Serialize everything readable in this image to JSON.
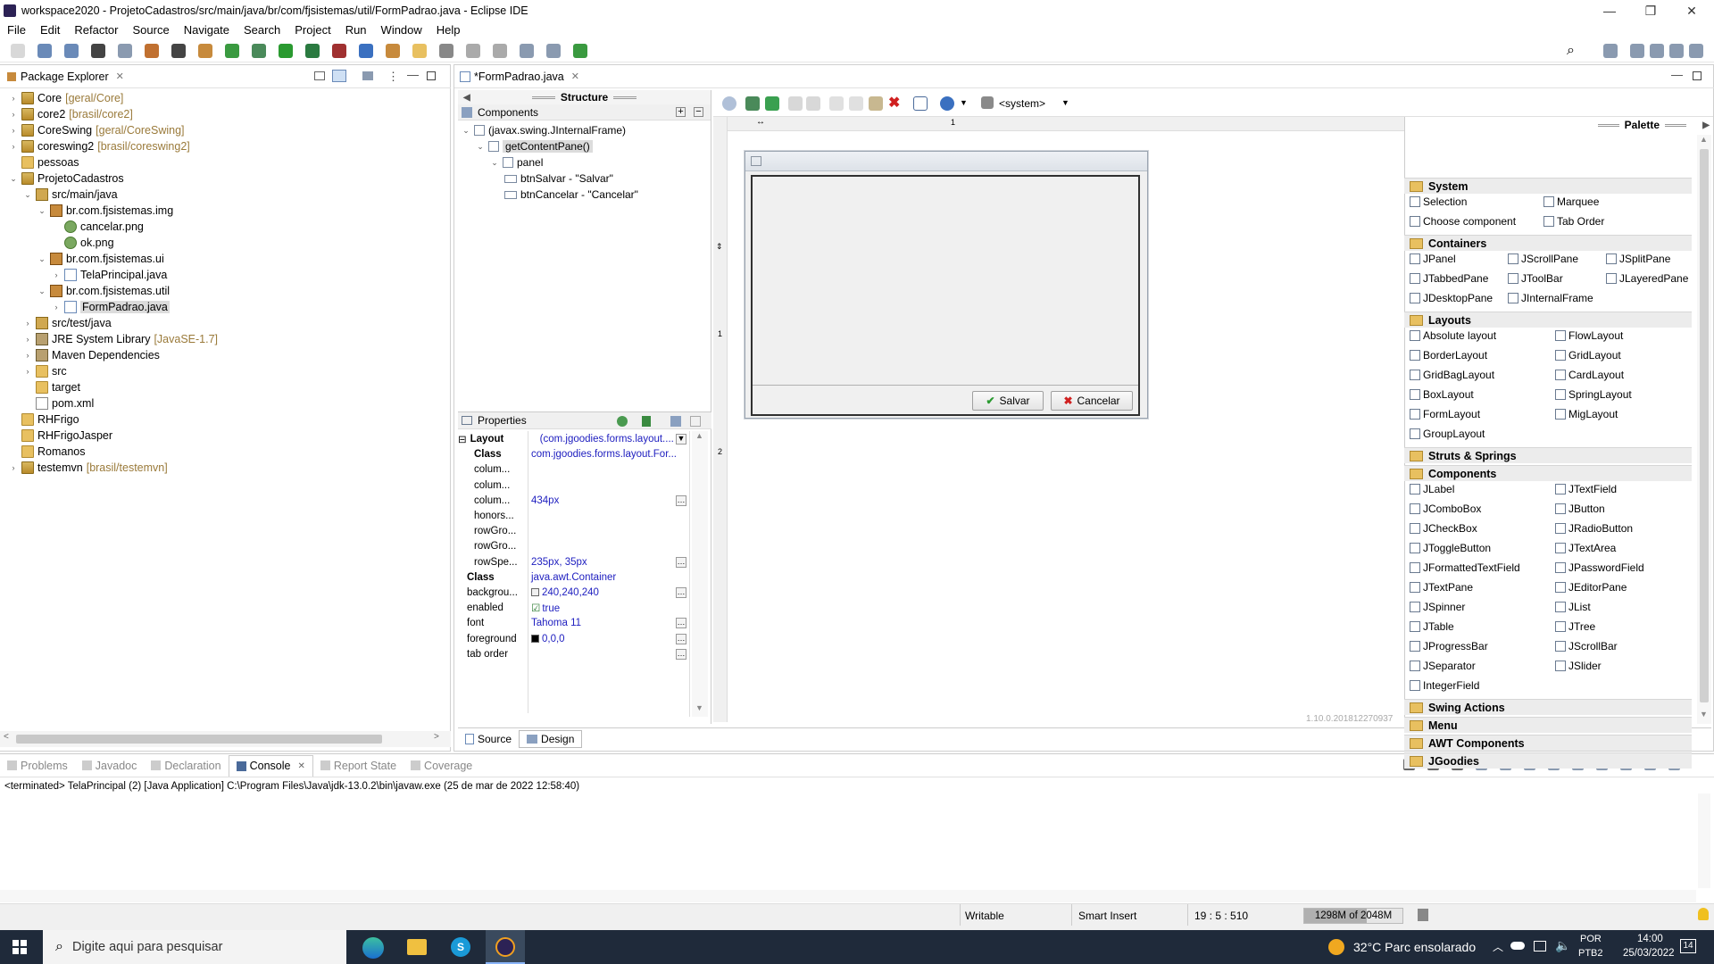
{
  "window": {
    "title": "workspace2020 - ProjetoCadastros/src/main/java/br/com/fjsistemas/util/FormPadrao.java - Eclipse IDE"
  },
  "menu": [
    "File",
    "Edit",
    "Refactor",
    "Source",
    "Navigate",
    "Search",
    "Project",
    "Run",
    "Window",
    "Help"
  ],
  "package_explorer": {
    "tab": "Package Explorer",
    "items": [
      {
        "label": "Core",
        "dec": "[geral/Core]",
        "icon": "project",
        "indent": 0,
        "twisty": ">"
      },
      {
        "label": "core2",
        "dec": "[brasil/core2]",
        "icon": "project",
        "indent": 0,
        "twisty": ">"
      },
      {
        "label": "CoreSwing",
        "dec": "[geral/CoreSwing]",
        "icon": "project",
        "indent": 0,
        "twisty": ">"
      },
      {
        "label": "coreswing2",
        "dec": "[brasil/coreswing2]",
        "icon": "project",
        "indent": 0,
        "twisty": ">"
      },
      {
        "label": "pessoas",
        "dec": "",
        "icon": "project-closed",
        "indent": 0,
        "twisty": ""
      },
      {
        "label": "ProjetoCadastros",
        "dec": "",
        "icon": "project",
        "indent": 0,
        "twisty": "v"
      },
      {
        "label": "src/main/java",
        "dec": "",
        "icon": "source-folder",
        "indent": 1,
        "twisty": "v"
      },
      {
        "label": "br.com.fjsistemas.img",
        "dec": "",
        "icon": "package",
        "indent": 2,
        "twisty": "v"
      },
      {
        "label": "cancelar.png",
        "dec": "",
        "icon": "image",
        "indent": 3,
        "twisty": ""
      },
      {
        "label": "ok.png",
        "dec": "",
        "icon": "image",
        "indent": 3,
        "twisty": ""
      },
      {
        "label": "br.com.fjsistemas.ui",
        "dec": "",
        "icon": "package",
        "indent": 2,
        "twisty": "v"
      },
      {
        "label": "TelaPrincipal.java",
        "dec": "",
        "icon": "java",
        "indent": 3,
        "twisty": ">"
      },
      {
        "label": "br.com.fjsistemas.util",
        "dec": "",
        "icon": "package",
        "indent": 2,
        "twisty": "v"
      },
      {
        "label": "FormPadrao.java",
        "dec": "",
        "icon": "java",
        "indent": 3,
        "twisty": ">",
        "selected": true
      },
      {
        "label": "src/test/java",
        "dec": "",
        "icon": "source-folder",
        "indent": 1,
        "twisty": ">"
      },
      {
        "label": "JRE System Library",
        "dec": "[JavaSE-1.7]",
        "icon": "library",
        "indent": 1,
        "twisty": ">"
      },
      {
        "label": "Maven Dependencies",
        "dec": "",
        "icon": "library",
        "indent": 1,
        "twisty": ">"
      },
      {
        "label": "src",
        "dec": "",
        "icon": "folder",
        "indent": 1,
        "twisty": ">"
      },
      {
        "label": "target",
        "dec": "",
        "icon": "folder",
        "indent": 1,
        "twisty": ""
      },
      {
        "label": "pom.xml",
        "dec": "",
        "icon": "xml",
        "indent": 1,
        "twisty": ""
      },
      {
        "label": "RHFrigo",
        "dec": "",
        "icon": "project-closed",
        "indent": 0,
        "twisty": ""
      },
      {
        "label": "RHFrigoJasper",
        "dec": "",
        "icon": "project-closed",
        "indent": 0,
        "twisty": ""
      },
      {
        "label": "Romanos",
        "dec": "",
        "icon": "project-closed",
        "indent": 0,
        "twisty": ""
      },
      {
        "label": "testemvn",
        "dec": "[brasil/testemvn]",
        "icon": "project",
        "indent": 0,
        "twisty": ">"
      }
    ]
  },
  "editor": {
    "tab": "*FormPadrao.java",
    "structure_title": "Structure",
    "components_title": "Components",
    "components": [
      {
        "label": "(javax.swing.JInternalFrame)",
        "indent": 0
      },
      {
        "label": "getContentPane()",
        "indent": 1
      },
      {
        "label": "panel",
        "indent": 2
      },
      {
        "label": "btnSalvar - \"Salvar\"",
        "indent": 3
      },
      {
        "label": "btnCancelar - \"Cancelar\"",
        "indent": 3
      }
    ],
    "properties_title": "Properties",
    "properties": [
      {
        "k": "Layout",
        "v": "(com.jgoodies.forms.layout....",
        "bold": true,
        "group": true
      },
      {
        "k": "Class",
        "v": "com.jgoodies.forms.layout.For...",
        "bold": true
      },
      {
        "k": "colum...",
        "v": ""
      },
      {
        "k": "colum...",
        "v": ""
      },
      {
        "k": "colum...",
        "v": "434px",
        "more": true
      },
      {
        "k": "honors...",
        "v": ""
      },
      {
        "k": "rowGro...",
        "v": ""
      },
      {
        "k": "rowGro...",
        "v": ""
      },
      {
        "k": "rowSpe...",
        "v": "235px, 35px",
        "more": true
      },
      {
        "k": "Class",
        "v": "java.awt.Container",
        "bold": true,
        "top": true
      },
      {
        "k": "backgrou...",
        "v": "240,240,240",
        "more": true,
        "swatch": "#f0f0f0",
        "top": true
      },
      {
        "k": "enabled",
        "v": "true",
        "check": true,
        "top": true
      },
      {
        "k": "font",
        "v": "Tahoma 11",
        "more": true,
        "top": true
      },
      {
        "k": "foreground",
        "v": "0,0,0",
        "more": true,
        "swatch": "#000000",
        "top": true
      },
      {
        "k": "tab order",
        "v": "",
        "more": true,
        "top": true
      }
    ],
    "system_combo": "<system>",
    "ruler_top": "1",
    "ruler_left_1": "1",
    "ruler_left_2": "2",
    "form_btn_save": "Salvar",
    "form_btn_cancel": "Cancelar",
    "version": "1.10.0.201812270937",
    "bottom_tabs": [
      "Source",
      "Design"
    ]
  },
  "palette": {
    "title": "Palette",
    "categories": [
      {
        "name": "System",
        "items": [
          "Selection",
          "Marquee",
          "Choose component",
          "Tab Order"
        ]
      },
      {
        "name": "Containers",
        "items": [
          "JPanel",
          "JScrollPane",
          "JSplitPane",
          "JTabbedPane",
          "JToolBar",
          "JLayeredPane",
          "JDesktopPane",
          "JInternalFrame"
        ]
      },
      {
        "name": "Layouts",
        "items": [
          "Absolute layout",
          "FlowLayout",
          "BorderLayout",
          "GridLayout",
          "GridBagLayout",
          "CardLayout",
          "BoxLayout",
          "SpringLayout",
          "FormLayout",
          "MigLayout",
          "GroupLayout"
        ]
      },
      {
        "name": "Struts & Springs",
        "items": []
      },
      {
        "name": "Components",
        "items": [
          "JLabel",
          "JTextField",
          "JComboBox",
          "JButton",
          "JCheckBox",
          "JRadioButton",
          "JToggleButton",
          "JTextArea",
          "JFormattedTextField",
          "JPasswordField",
          "JTextPane",
          "JEditorPane",
          "JSpinner",
          "JList",
          "JTable",
          "JTree",
          "JProgressBar",
          "JScrollBar",
          "JSeparator",
          "JSlider",
          "IntegerField"
        ]
      },
      {
        "name": "Swing Actions",
        "items": []
      },
      {
        "name": "Menu",
        "items": []
      },
      {
        "name": "AWT Components",
        "items": []
      },
      {
        "name": "JGoodies",
        "items": []
      }
    ]
  },
  "console": {
    "tabs": [
      "Problems",
      "Javadoc",
      "Declaration",
      "Console",
      "Report State",
      "Coverage"
    ],
    "active": "Console",
    "line": "<terminated> TelaPrincipal (2) [Java Application] C:\\Program Files\\Java\\jdk-13.0.2\\bin\\javaw.exe (25 de mar de 2022 12:58:40)"
  },
  "status": {
    "writable": "Writable",
    "insert": "Smart Insert",
    "position": "19 : 5 : 510",
    "memory": "1298M of 2048M",
    "memory_used_fraction": 0.634
  },
  "taskbar": {
    "search": "Digite aqui para pesquisar",
    "weather": "32°C  Parc ensolarado",
    "lang1": "POR",
    "lang2": "PTB2",
    "time": "14:00",
    "date": "25/03/2022",
    "notif": "14"
  }
}
